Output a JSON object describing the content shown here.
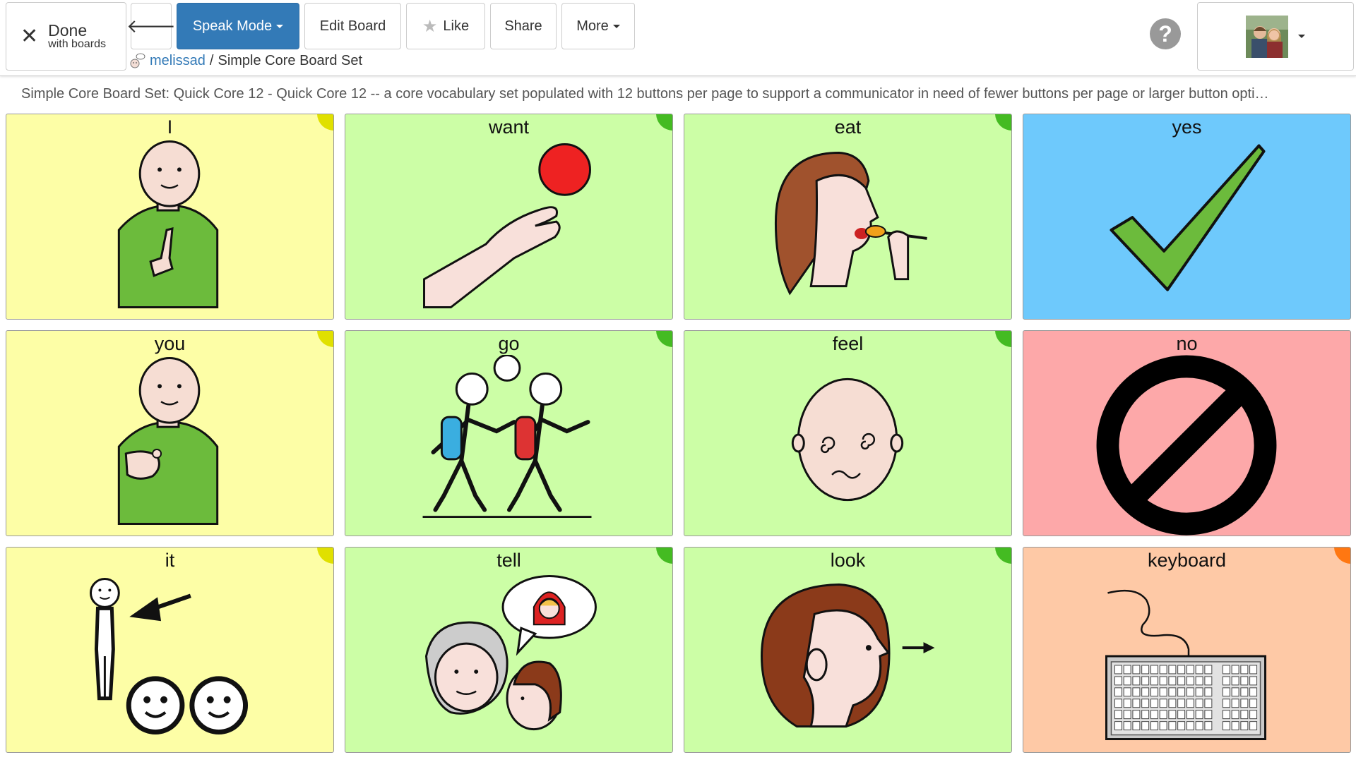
{
  "header": {
    "done": {
      "label": "Done",
      "sublabel": "with boards"
    },
    "speak_mode": "Speak Mode",
    "edit_board": "Edit Board",
    "like": "Like",
    "share": "Share",
    "more": "More",
    "help": "?",
    "breadcrumb": {
      "user": "melissad",
      "separator": "/",
      "board": "Simple Core Board Set"
    }
  },
  "description": "Simple Core Board Set: Quick Core 12 - Quick Core 12 -- a core vocabulary set populated with 12 buttons per page to support a communicator in need of fewer buttons per page or larger button opti…",
  "colors": {
    "yellow": "#fdfea6",
    "green": "#ccfea6",
    "blue": "#6ec9fc",
    "red": "#fda8a9",
    "orange": "#fec9a6",
    "corner_yellow": "#e0e000",
    "corner_green": "#44bb22",
    "corner_orange": "#ff7711",
    "primary": "#337ab7"
  },
  "board": {
    "buttons": [
      {
        "label": "I",
        "icon": "person-pointing-self-icon"
      },
      {
        "label": "want",
        "icon": "hand-reaching-ball-icon"
      },
      {
        "label": "eat",
        "icon": "person-eating-spoon-icon"
      },
      {
        "label": "yes",
        "icon": "checkmark-icon"
      },
      {
        "label": "you",
        "icon": "person-pointing-you-icon"
      },
      {
        "label": "go",
        "icon": "people-walking-icon"
      },
      {
        "label": "feel",
        "icon": "dizzy-face-icon"
      },
      {
        "label": "no",
        "icon": "prohibited-icon"
      },
      {
        "label": "it",
        "icon": "figure-arrow-faces-icon"
      },
      {
        "label": "tell",
        "icon": "people-telling-story-icon"
      },
      {
        "label": "look",
        "icon": "head-looking-arrow-icon"
      },
      {
        "label": "keyboard",
        "icon": "keyboard-icon"
      }
    ]
  }
}
